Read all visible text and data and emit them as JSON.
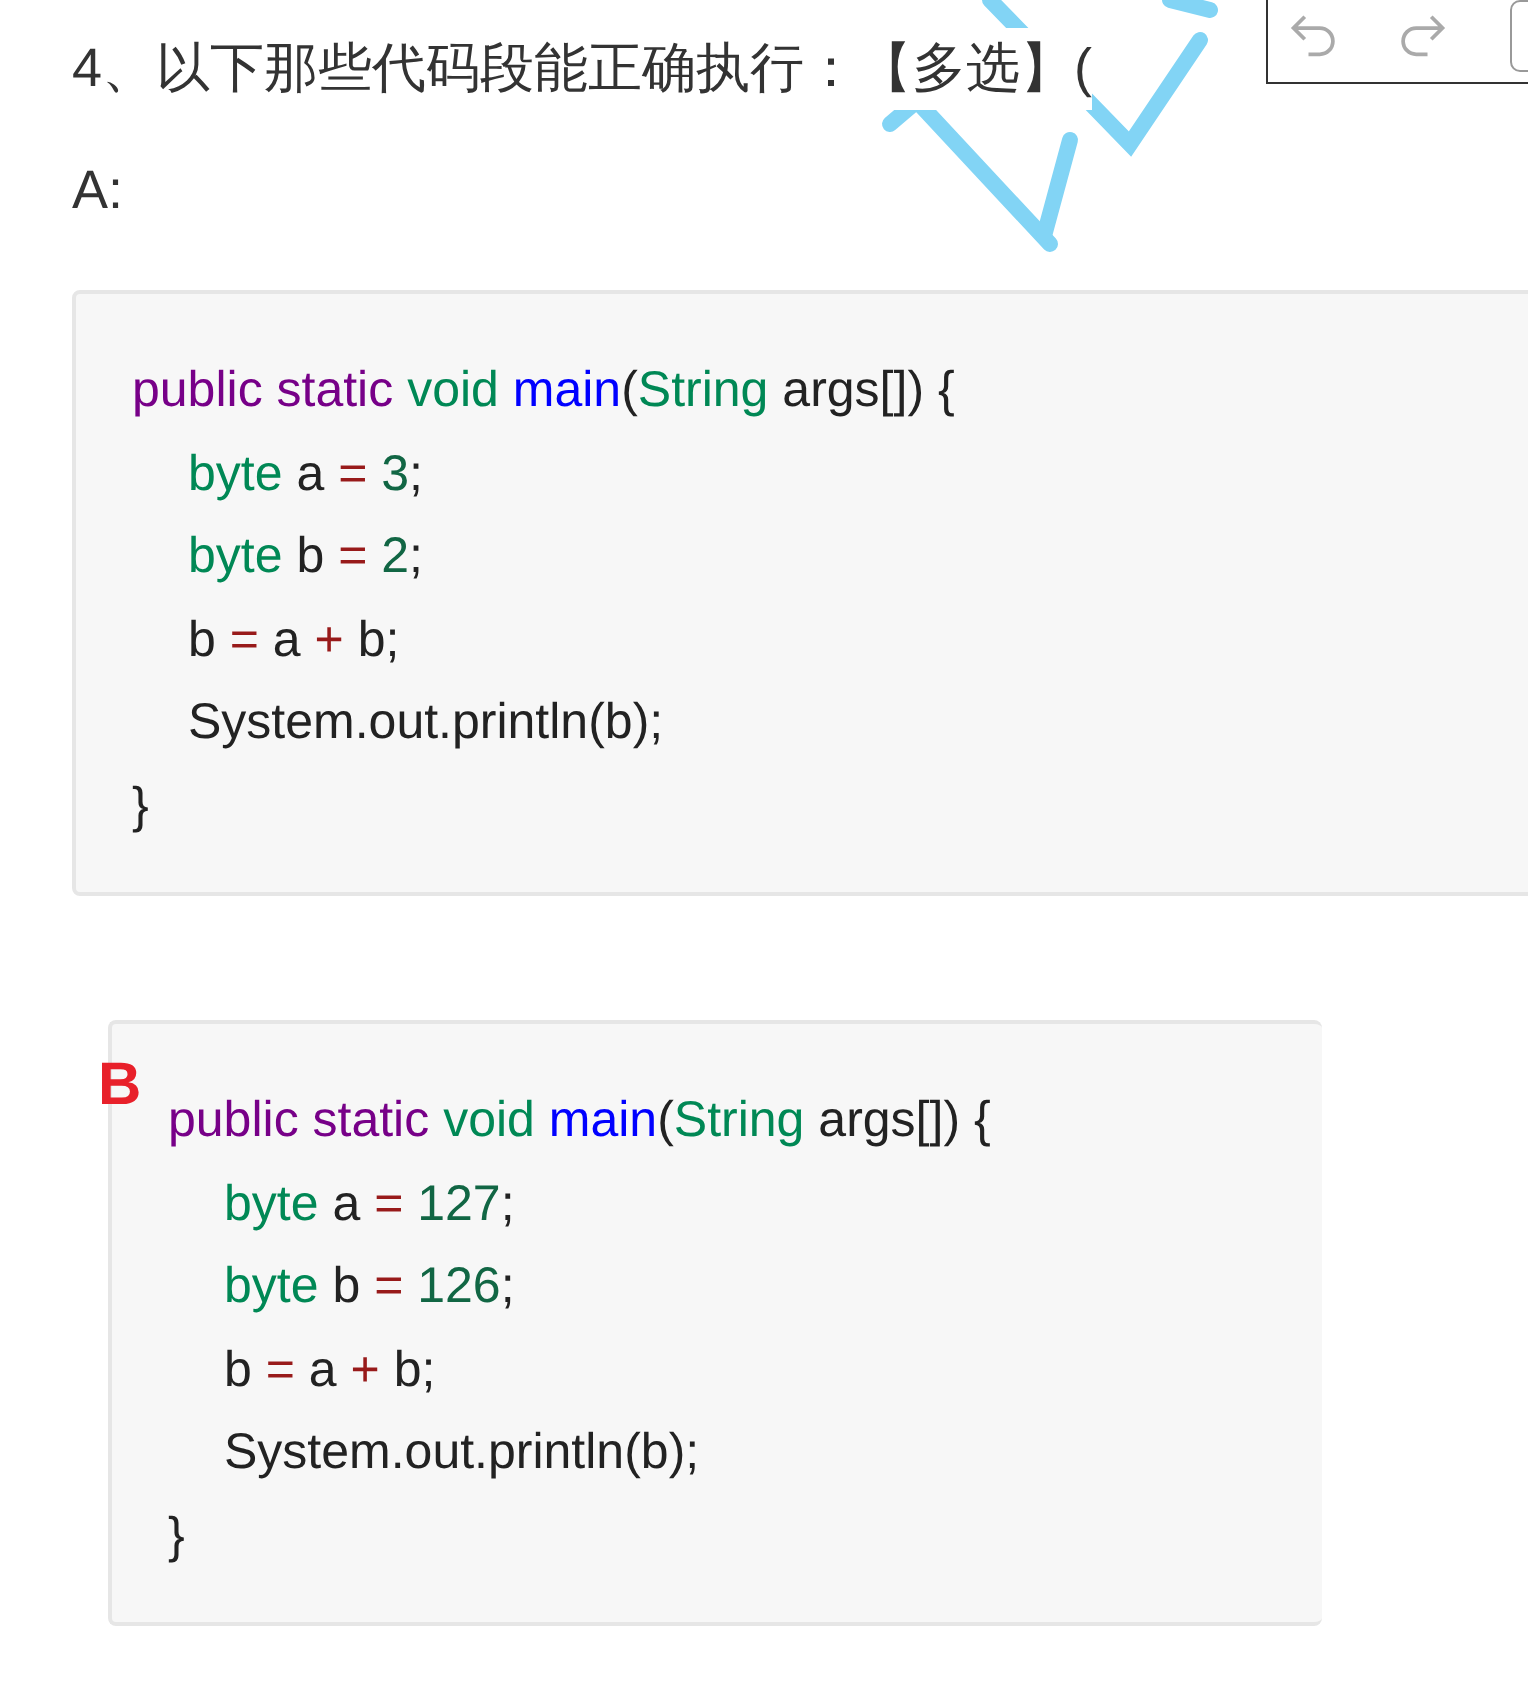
{
  "question": {
    "title": "4、以下那些代码段能正确执行：【多选】("
  },
  "toolbar": {
    "buttons": [
      {
        "kind": "undo",
        "disabled": true
      },
      {
        "kind": "redo",
        "disabled": true
      }
    ]
  },
  "options": [
    {
      "label": "A:",
      "kind": "plain",
      "code": [
        {
          "tokens": [
            {
              "kind": "keyword",
              "text": "public static"
            },
            {
              "kind": "type",
              "text": " void "
            },
            {
              "kind": "func",
              "text": "main"
            },
            {
              "kind": "plain",
              "text": "("
            },
            {
              "kind": "type",
              "text": "String"
            },
            {
              "kind": "plain",
              "text": " args[]) {"
            }
          ],
          "children": [
            {
              "tokens": [
                {
                  "kind": "type",
                  "text": "byte"
                },
                {
                  "kind": "plain",
                  "text": " a "
                },
                {
                  "kind": "op",
                  "text": "="
                },
                {
                  "kind": "num",
                  "text": " 3"
                },
                {
                  "kind": "plain",
                  "text": ";"
                }
              ]
            },
            {
              "tokens": [
                {
                  "kind": "type",
                  "text": "byte"
                },
                {
                  "kind": "plain",
                  "text": " b "
                },
                {
                  "kind": "op",
                  "text": "="
                },
                {
                  "kind": "num",
                  "text": " 2"
                },
                {
                  "kind": "plain",
                  "text": ";"
                }
              ]
            },
            {
              "tokens": [
                {
                  "kind": "plain",
                  "text": "b "
                },
                {
                  "kind": "op",
                  "text": "="
                },
                {
                  "kind": "plain",
                  "text": " a "
                },
                {
                  "kind": "op",
                  "text": "+"
                },
                {
                  "kind": "plain",
                  "text": " b;"
                }
              ]
            },
            {
              "tokens": [
                {
                  "kind": "plain",
                  "text": "System.out.println(b);"
                }
              ]
            }
          ]
        },
        {
          "tokens": [
            {
              "kind": "plain",
              "text": "}"
            }
          ]
        }
      ]
    },
    {
      "label": "B",
      "kind": "marker",
      "code": [
        {
          "tokens": [
            {
              "kind": "keyword",
              "text": "public static"
            },
            {
              "kind": "type",
              "text": " void "
            },
            {
              "kind": "func",
              "text": "main"
            },
            {
              "kind": "plain",
              "text": "("
            },
            {
              "kind": "type",
              "text": "String"
            },
            {
              "kind": "plain",
              "text": " args[]) {"
            }
          ],
          "children": [
            {
              "tokens": [
                {
                  "kind": "type",
                  "text": "byte"
                },
                {
                  "kind": "plain",
                  "text": " a "
                },
                {
                  "kind": "op",
                  "text": "="
                },
                {
                  "kind": "num",
                  "text": " 127"
                },
                {
                  "kind": "plain",
                  "text": ";"
                }
              ]
            },
            {
              "tokens": [
                {
                  "kind": "type",
                  "text": "byte"
                },
                {
                  "kind": "plain",
                  "text": " b "
                },
                {
                  "kind": "op",
                  "text": "="
                },
                {
                  "kind": "num",
                  "text": " 126"
                },
                {
                  "kind": "plain",
                  "text": ";"
                }
              ]
            },
            {
              "tokens": [
                {
                  "kind": "plain",
                  "text": "b "
                },
                {
                  "kind": "op",
                  "text": "="
                },
                {
                  "kind": "plain",
                  "text": " a "
                },
                {
                  "kind": "op",
                  "text": "+"
                },
                {
                  "kind": "plain",
                  "text": " b;"
                }
              ]
            },
            {
              "tokens": [
                {
                  "kind": "plain",
                  "text": "System.out.println(b);"
                }
              ]
            }
          ]
        },
        {
          "tokens": [
            {
              "kind": "plain",
              "text": "}"
            }
          ]
        }
      ]
    }
  ]
}
